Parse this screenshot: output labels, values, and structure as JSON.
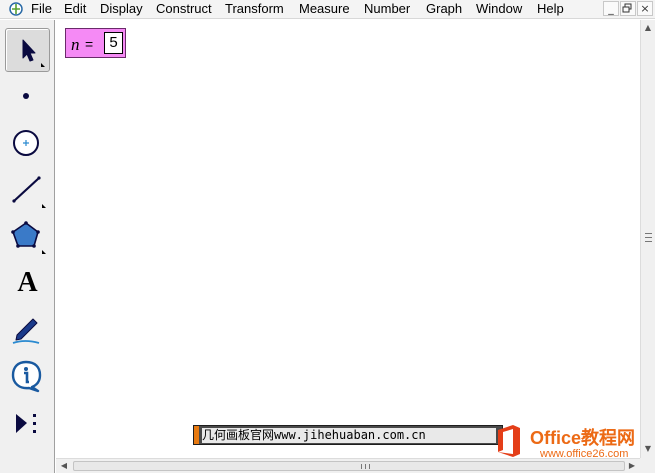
{
  "menubar": {
    "items": [
      "File",
      "Edit",
      "Display",
      "Construct",
      "Transform",
      "Measure",
      "Number",
      "Graph",
      "Window",
      "Help"
    ],
    "window_buttons": {
      "minimize": "_",
      "restore": "б",
      "close": "×"
    }
  },
  "toolbox": {
    "tools": [
      {
        "name": "arrow-tool",
        "icon": "arrow-pointer-icon",
        "selected": true
      },
      {
        "name": "point-tool",
        "icon": "point-icon"
      },
      {
        "name": "compass-tool",
        "icon": "compass-circle-icon"
      },
      {
        "name": "straightedge-tool",
        "icon": "line-segment-icon"
      },
      {
        "name": "polygon-tool",
        "icon": "pentagon-icon"
      },
      {
        "name": "text-tool",
        "icon": "letter-a-icon",
        "label": "A"
      },
      {
        "name": "marker-tool",
        "icon": "pen-icon"
      },
      {
        "name": "information-tool",
        "icon": "info-bubble-icon"
      },
      {
        "name": "custom-tools",
        "icon": "play-more-icon"
      }
    ]
  },
  "parameter": {
    "name": "n",
    "equals": "=",
    "value": "5"
  },
  "watermark": {
    "text": "几何画板官网www.jihehuaban.com.cn"
  },
  "branding": {
    "name": "Office教程网",
    "url": "www.office26.com"
  },
  "colors": {
    "parameter_fill": "#f58af5",
    "brand_orange": "#ec6a15",
    "logo_red": "#e43e18"
  }
}
